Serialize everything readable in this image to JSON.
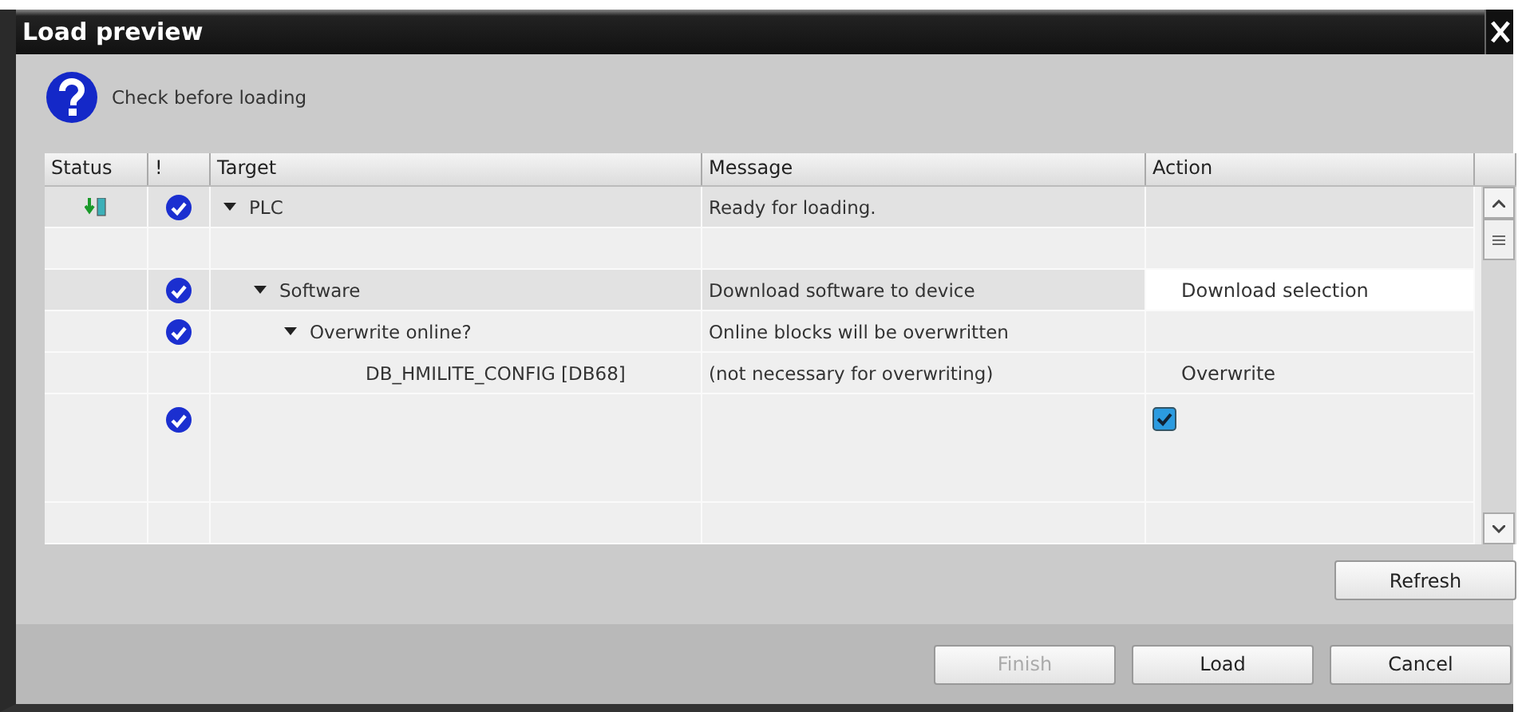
{
  "window": {
    "title": "Load preview"
  },
  "header": {
    "text": "Check before loading"
  },
  "table": {
    "columns": [
      "Status",
      "!",
      "Target",
      "Message",
      "Action"
    ],
    "rows": [
      {
        "kind": "download",
        "ok": true,
        "highlighted": true,
        "expanded": true,
        "target": "PLC",
        "message": "Ready for loading.",
        "children": [
          {
            "ok": false,
            "highlighted": false
          },
          {
            "ok": true,
            "highlighted": true,
            "expanded": true,
            "target": "Software",
            "message": "Download software to device",
            "action": {
              "kind": "text",
              "text": "Download selection",
              "selected": true
            },
            "children": [
              {
                "ok": true,
                "highlighted": false,
                "expanded": true,
                "target": "Overwrite online?",
                "message": "Online blocks will be overwritten",
                "children": [
                  {
                    "ok": false,
                    "highlighted": false,
                    "target": "DB_HMILITE_CONFIG [DB68]",
                    "message": "(not necessary for overwriting)",
                    "action": {
                      "kind": "text",
                      "text": "Overwrite",
                      "selected": false
                    }
                  },
                  {
                    "ok": true,
                    "highlighted": false,
                    "action": {
                      "kind": "checkbox",
                      "checked": true
                    }
                  }
                ]
              }
            ]
          }
        ]
      },
      {
        "ok": false,
        "highlighted": false
      }
    ]
  },
  "buttons": [
    {
      "label": "Refresh",
      "disabled": false
    }
  ],
  "footer_buttons": [
    {
      "label": "Finish",
      "disabled": true
    },
    {
      "label": "Load",
      "disabled": false
    },
    {
      "label": "Cancel",
      "disabled": false
    }
  ]
}
